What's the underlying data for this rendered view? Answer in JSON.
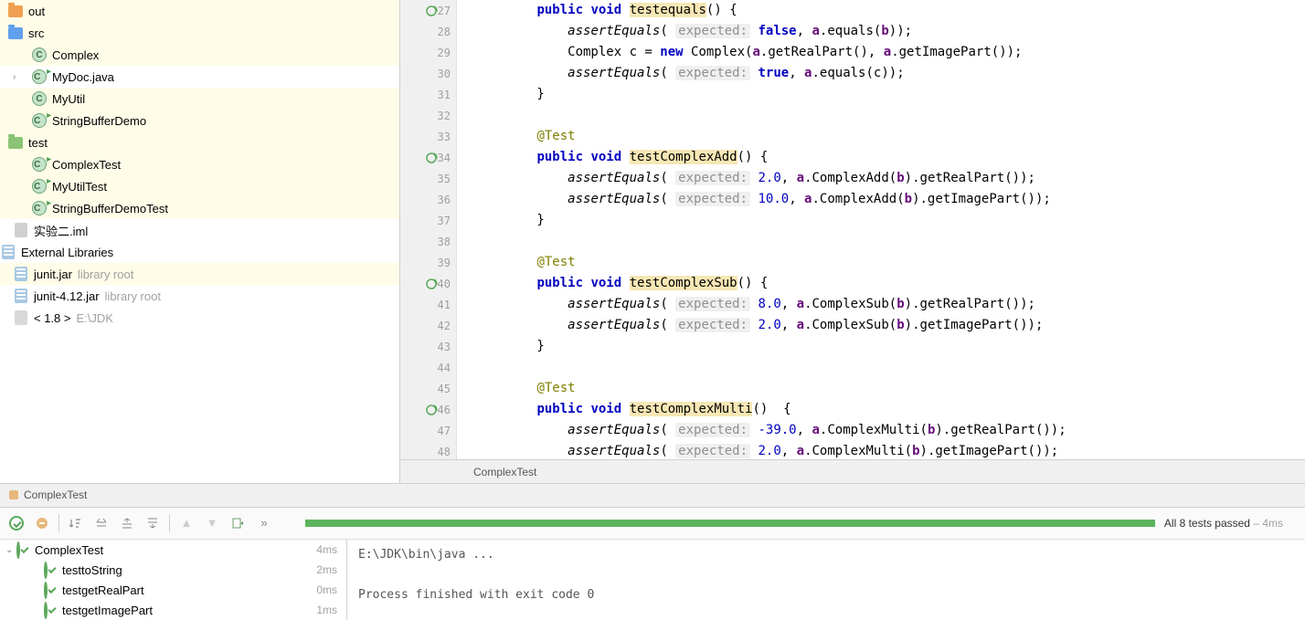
{
  "project_tree": {
    "out": "out",
    "src": "src",
    "src_items": [
      "Complex",
      "MyDoc.java",
      "MyUtil",
      "StringBufferDemo"
    ],
    "test": "test",
    "test_items": [
      "ComplexTest",
      "MyUtilTest",
      "StringBufferDemoTest"
    ],
    "iml": "实验二.iml",
    "ext_lib": "External Libraries",
    "libs": [
      {
        "name": "junit.jar",
        "hint": "library root"
      },
      {
        "name": "junit-4.12.jar",
        "hint": "library root"
      }
    ],
    "jdk": "< 1.8 >",
    "jdk_hint": "E:\\JDK"
  },
  "code": {
    "lines": {
      "27": {
        "type": "method",
        "kw1": "public",
        "kw2": "void",
        "name": "testequals",
        "suffix": "() {"
      },
      "28": {
        "type": "assert",
        "call": "assertEquals",
        "expected_lbl": "expected:",
        "expected": "false",
        "after": ", ",
        "var1": "a",
        "rest": ".equals(",
        "var2": "b",
        "tail": "));"
      },
      "29": {
        "type": "stmt",
        "text_pre": "Complex c = ",
        "kw": "new",
        "text_mid": " Complex(",
        "var1": "a",
        "m1": ".getRealPart(), ",
        "var2": "a",
        "m2": ".getImagePart());"
      },
      "30": {
        "type": "assert",
        "call": "assertEquals",
        "expected_lbl": "expected:",
        "expected": "true",
        "after": ", ",
        "var1": "a",
        "rest": ".equals(c));"
      },
      "31": {
        "type": "close",
        "text": "}"
      },
      "32": {
        "type": "blank"
      },
      "33": {
        "type": "anno",
        "text": "@Test"
      },
      "34": {
        "type": "method",
        "kw1": "public",
        "kw2": "void",
        "name": "testComplexAdd",
        "suffix": "() {"
      },
      "35": {
        "type": "assert2",
        "call": "assertEquals",
        "expected_lbl": "expected:",
        "expected": "2.0",
        "after": ", ",
        "var1": "a",
        "m": ".ComplexAdd(",
        "var2": "b",
        "tail": ").getRealPart());"
      },
      "36": {
        "type": "assert2",
        "call": "assertEquals",
        "expected_lbl": "expected:",
        "expected": "10.0",
        "after": ", ",
        "var1": "a",
        "m": ".ComplexAdd(",
        "var2": "b",
        "tail": ").getImagePart());"
      },
      "37": {
        "type": "close",
        "text": "}"
      },
      "38": {
        "type": "blank"
      },
      "39": {
        "type": "anno",
        "text": "@Test"
      },
      "40": {
        "type": "method",
        "kw1": "public",
        "kw2": "void",
        "name": "testComplexSub",
        "suffix": "() {"
      },
      "41": {
        "type": "assert2",
        "call": "assertEquals",
        "expected_lbl": "expected:",
        "expected": "8.0",
        "after": ", ",
        "var1": "a",
        "m": ".ComplexSub(",
        "var2": "b",
        "tail": ").getRealPart());"
      },
      "42": {
        "type": "assert2",
        "call": "assertEquals",
        "expected_lbl": "expected:",
        "expected": "2.0",
        "after": ", ",
        "var1": "a",
        "m": ".ComplexSub(",
        "var2": "b",
        "tail": ").getImagePart());"
      },
      "43": {
        "type": "close",
        "text": "}"
      },
      "44": {
        "type": "blank"
      },
      "45": {
        "type": "anno",
        "text": "@Test"
      },
      "46": {
        "type": "method",
        "kw1": "public",
        "kw2": "void",
        "name": "testComplexMulti",
        "suffix": "()  {"
      },
      "47": {
        "type": "assert2",
        "call": "assertEquals",
        "expected_lbl": "expected:",
        "expected": "-39.0",
        "after": ", ",
        "var1": "a",
        "m": ".ComplexMulti(",
        "var2": "b",
        "tail": ").getRealPart());"
      },
      "48": {
        "type": "assert2",
        "call": "assertEquals",
        "expected_lbl": "expected:",
        "expected": "2.0",
        "after": ", ",
        "var1": "a",
        "m": ".ComplexMulti(",
        "var2": "b",
        "tail": ").getImagePart());"
      }
    }
  },
  "breadcrumb": "ComplexTest",
  "test_run": {
    "tab": "ComplexTest",
    "status": "All 8 tests passed",
    "status_time": " – 4ms",
    "root": {
      "name": "ComplexTest",
      "time": "4ms"
    },
    "items": [
      {
        "name": "testtoString",
        "time": "2ms"
      },
      {
        "name": "testgetRealPart",
        "time": "0ms"
      },
      {
        "name": "testgetImagePart",
        "time": "1ms"
      }
    ],
    "output": [
      "E:\\JDK\\bin\\java ...",
      "",
      "Process finished with exit code 0"
    ]
  }
}
